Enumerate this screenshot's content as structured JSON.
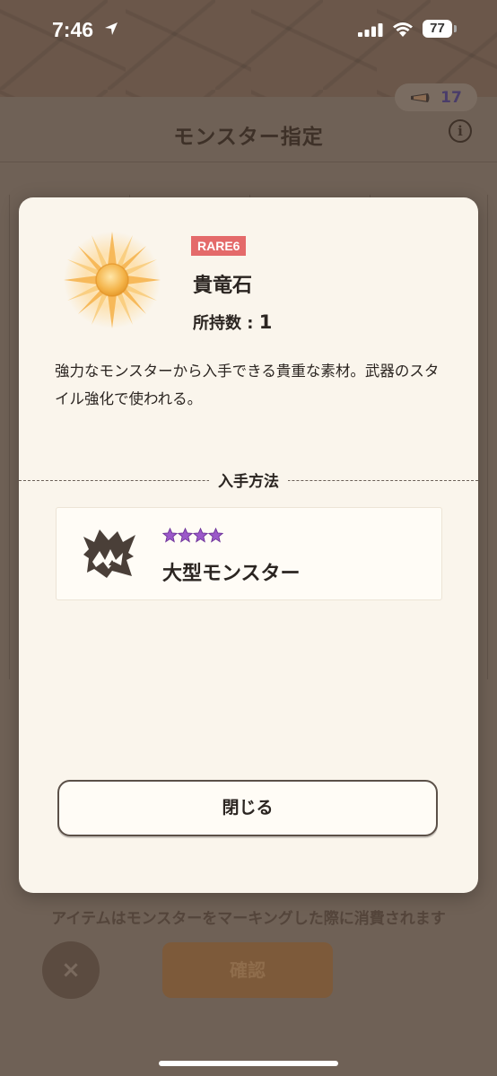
{
  "status_bar": {
    "time": "7:46",
    "battery": "77"
  },
  "background": {
    "title": "モンスター指定",
    "info_symbol": "i",
    "currency_count": "17",
    "footer_text": "アイテムはモンスターをマーキングした際に消費されます",
    "close_symbol": "×",
    "confirm_label": "確認"
  },
  "modal": {
    "rarity": "RARE6",
    "item_name": "貴竜石",
    "owned_label": "所持数 : ",
    "owned_count": "1",
    "description": "強力なモンスターから入手できる貴重な素材。武器のスタイル強化で使われる。",
    "section_title": "入手方法",
    "source": {
      "stars": 4,
      "label": "大型モンスター"
    },
    "close_button": "閉じる"
  },
  "colors": {
    "rarity_badge": "#e46a6a",
    "star_fill": "#9b59c9",
    "modal_bg": "#faf5ec"
  },
  "icons": [
    "location-arrow-icon",
    "signal-icon",
    "wifi-icon",
    "battery-icon",
    "horn-icon",
    "info-icon",
    "sun-stone-icon",
    "monster-fang-icon",
    "star-icon",
    "close-x-icon"
  ]
}
